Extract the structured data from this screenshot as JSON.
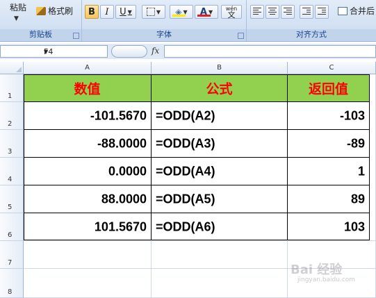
{
  "ribbon": {
    "clipboard": {
      "paste_label": "粘贴",
      "format_painter_label": "格式刷",
      "group_label": "剪贴板"
    },
    "font": {
      "bold": "B",
      "italic": "I",
      "underline": "U",
      "font_color_glyph": "A",
      "phonetic_glyph": "wén",
      "group_label": "字体"
    },
    "alignment": {
      "merge_label": "合并后",
      "group_label": "对齐方式"
    }
  },
  "formula_bar": {
    "name_box": "F4",
    "fx": "fx",
    "formula": ""
  },
  "columns": [
    "A",
    "B",
    "C"
  ],
  "rows": [
    "1",
    "2",
    "3",
    "4",
    "5",
    "6",
    "7",
    "8"
  ],
  "table": {
    "headers": [
      "数值",
      "公式",
      "返回值"
    ],
    "rows": [
      [
        "-101.5670",
        "=ODD(A2)",
        "-103"
      ],
      [
        "-88.0000",
        "=ODD(A3)",
        "-89"
      ],
      [
        "0.0000",
        "=ODD(A4)",
        "1"
      ],
      [
        "88.0000",
        "=ODD(A5)",
        "89"
      ],
      [
        "101.5670",
        "=ODD(A6)",
        "103"
      ]
    ]
  },
  "watermark": {
    "text": "Bai 经验",
    "sub": "jingyan.baidu.com"
  },
  "colors": {
    "header_fill": "#92d050",
    "header_text": "#ff0000"
  }
}
